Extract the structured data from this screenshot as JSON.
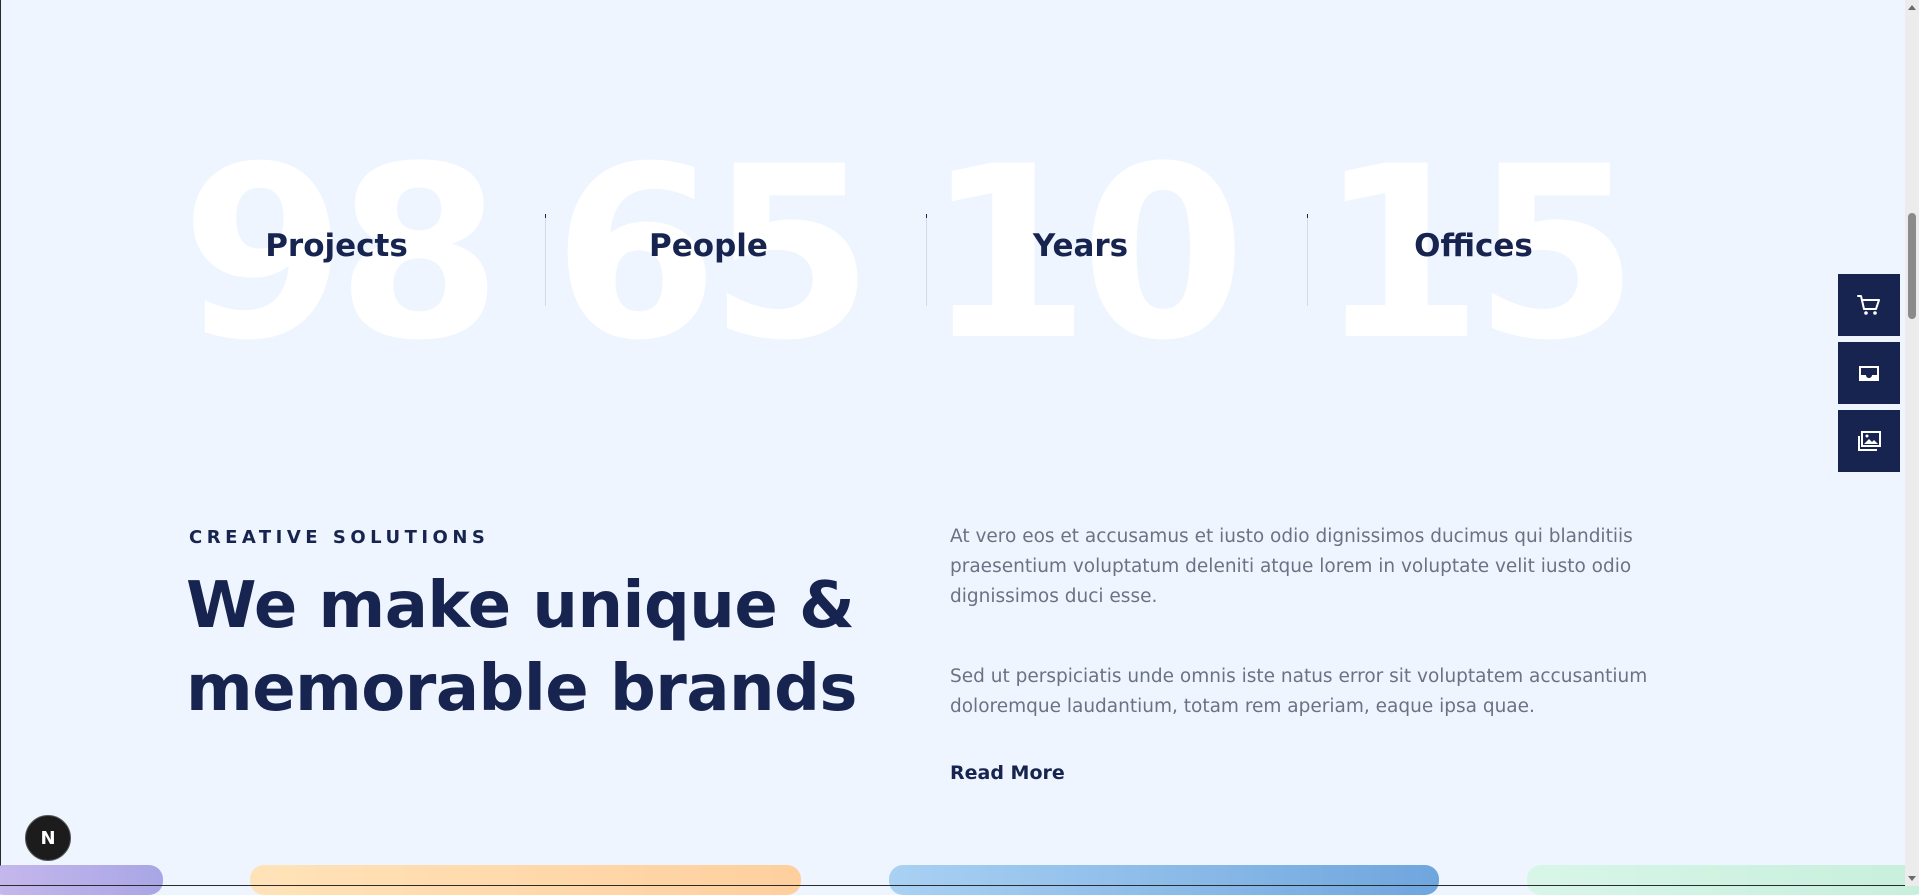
{
  "stats": [
    {
      "number": "98",
      "label": "Projects"
    },
    {
      "number": "65",
      "label": "People"
    },
    {
      "number": "10",
      "label": "Years"
    },
    {
      "number": "15",
      "label": "Offices"
    }
  ],
  "side_buttons": [
    {
      "icon": "cart-icon"
    },
    {
      "icon": "inbox-icon"
    },
    {
      "icon": "images-icon"
    }
  ],
  "creative": {
    "eyebrow": "CREATIVE SOLUTIONS",
    "headline_line1": "We make unique &",
    "headline_line2": "memorable brands",
    "paragraph1": "At vero eos et accusamus et iusto odio dignissimos ducimus qui blanditiis praesentium voluptatum deleniti atque lorem in voluptate velit iusto odio dignissimos duci esse.",
    "paragraph2": "Sed ut perspiciatis unde omnis iste natus error sit voluptatem accusantium doloremque laudantium, totam rem aperiam, eaque ipsa quae.",
    "read_more": "Read More"
  },
  "next_badge": {
    "letter": "N"
  },
  "colors": {
    "background": "#eef5ff",
    "navy": "#16244f",
    "muted_text": "#6a7384",
    "card_purple": "#b6a9e6",
    "card_orange": "#ffd7a8",
    "card_blue": "#8fbdea",
    "card_green": "#d3f3e4"
  }
}
